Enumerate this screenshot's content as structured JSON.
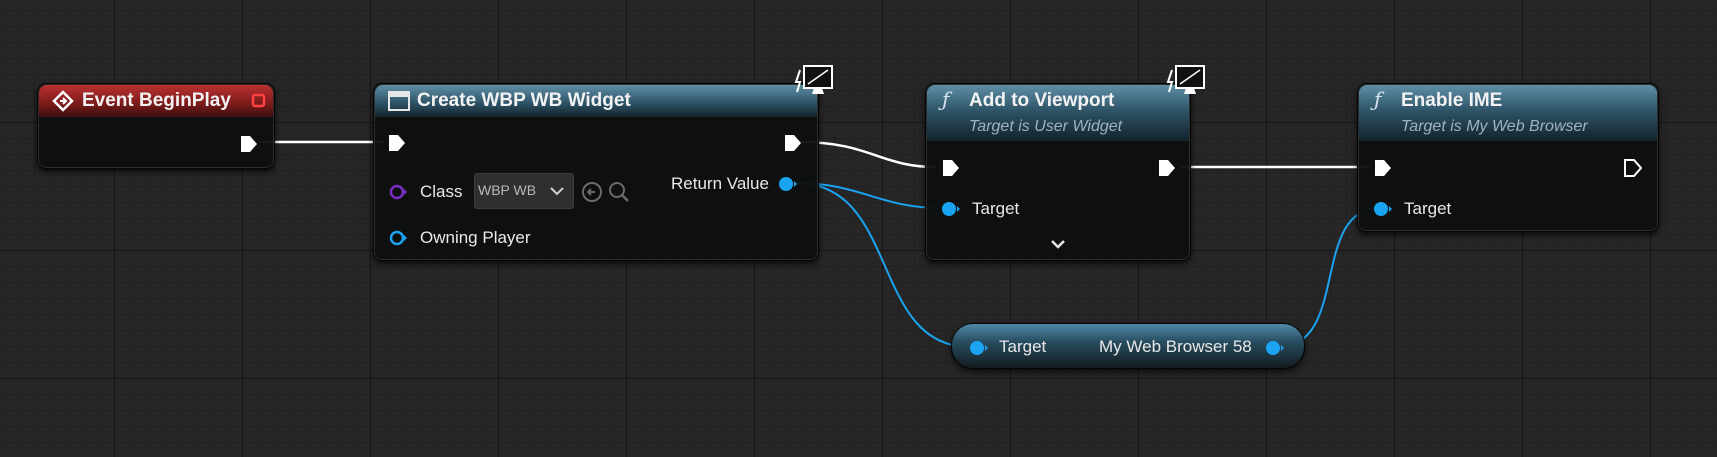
{
  "graph": {
    "nodes": {
      "event_begin_play": {
        "title": "Event BeginPlay"
      },
      "create_widget": {
        "title": "Create WBP WB Widget",
        "class_label": "Class",
        "class_value": "WBP WB",
        "owning_player_label": "Owning Player",
        "return_value_label": "Return Value"
      },
      "add_to_viewport": {
        "title": "Add to Viewport",
        "subtitle": "Target is User Widget",
        "target_label": "Target"
      },
      "enable_ime": {
        "title": "Enable IME",
        "subtitle": "Target is My Web Browser",
        "target_label": "Target"
      },
      "variable_getter": {
        "target_label": "Target",
        "output_label": "My Web Browser 58"
      }
    }
  },
  "colors": {
    "exec_wire": "#ffffff",
    "object_pin": "#1aa3f0",
    "class_pin": "#7a2ec4",
    "event_header": "#b02a2a",
    "function_header": "#3c6b82"
  },
  "icons": [
    "event-diamond-icon",
    "widget-icon",
    "function-icon",
    "network-monitor-icon",
    "chevron-down-icon",
    "browse-back-icon",
    "search-icon"
  ]
}
